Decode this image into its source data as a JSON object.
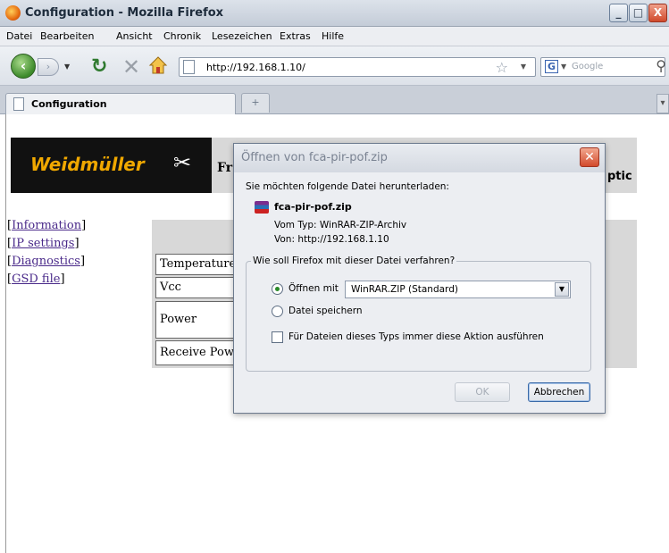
{
  "window": {
    "title": "Configuration - Mozilla Firefox",
    "buttons": {
      "minimize": "_",
      "maximize": "□",
      "close": "X"
    }
  },
  "menu": [
    "Datei",
    "Bearbeiten",
    "Ansicht",
    "Chronik",
    "Lesezeichen",
    "Extras",
    "Hilfe"
  ],
  "navbar": {
    "url": "http://192.168.1.10/",
    "search_placeholder": "Google"
  },
  "tabs": [
    {
      "label": "Configuration",
      "active": true
    }
  ],
  "page": {
    "logo_text": "Weidmüller",
    "logo_mark": "✂",
    "header_left_partial": "Fr",
    "header_right_partial": "ptic",
    "nav_links": [
      "Information",
      "IP settings",
      "Diagnostics",
      "GSD file"
    ],
    "rows": [
      "Temperature",
      "Vcc",
      "Power Margi",
      "Receive Pow"
    ]
  },
  "dialog": {
    "title": "Öffnen von fca-pir-pof.zip",
    "prompt": "Sie möchten folgende Datei herunterladen:",
    "filename": "fca-pir-pof.zip",
    "type_line": "Vom Typ:  WinRAR-ZIP-Archiv",
    "from_line": "Von:  http://192.168.1.10",
    "group_label": "Wie soll Firefox mit dieser Datei verfahren?",
    "open_with_label": "Öffnen mit",
    "open_with_value": "WinRAR.ZIP (Standard)",
    "save_label": "Datei speichern",
    "always_label": "Für Dateien dieses Typs immer diese Aktion ausführen",
    "ok_label": "OK",
    "cancel_label": "Abbrechen"
  },
  "colors": {
    "logo_bg": "#111111",
    "logo_text": "#f0a800",
    "link": "#4a2a8a",
    "panel_bg": "#d8d8d8"
  }
}
